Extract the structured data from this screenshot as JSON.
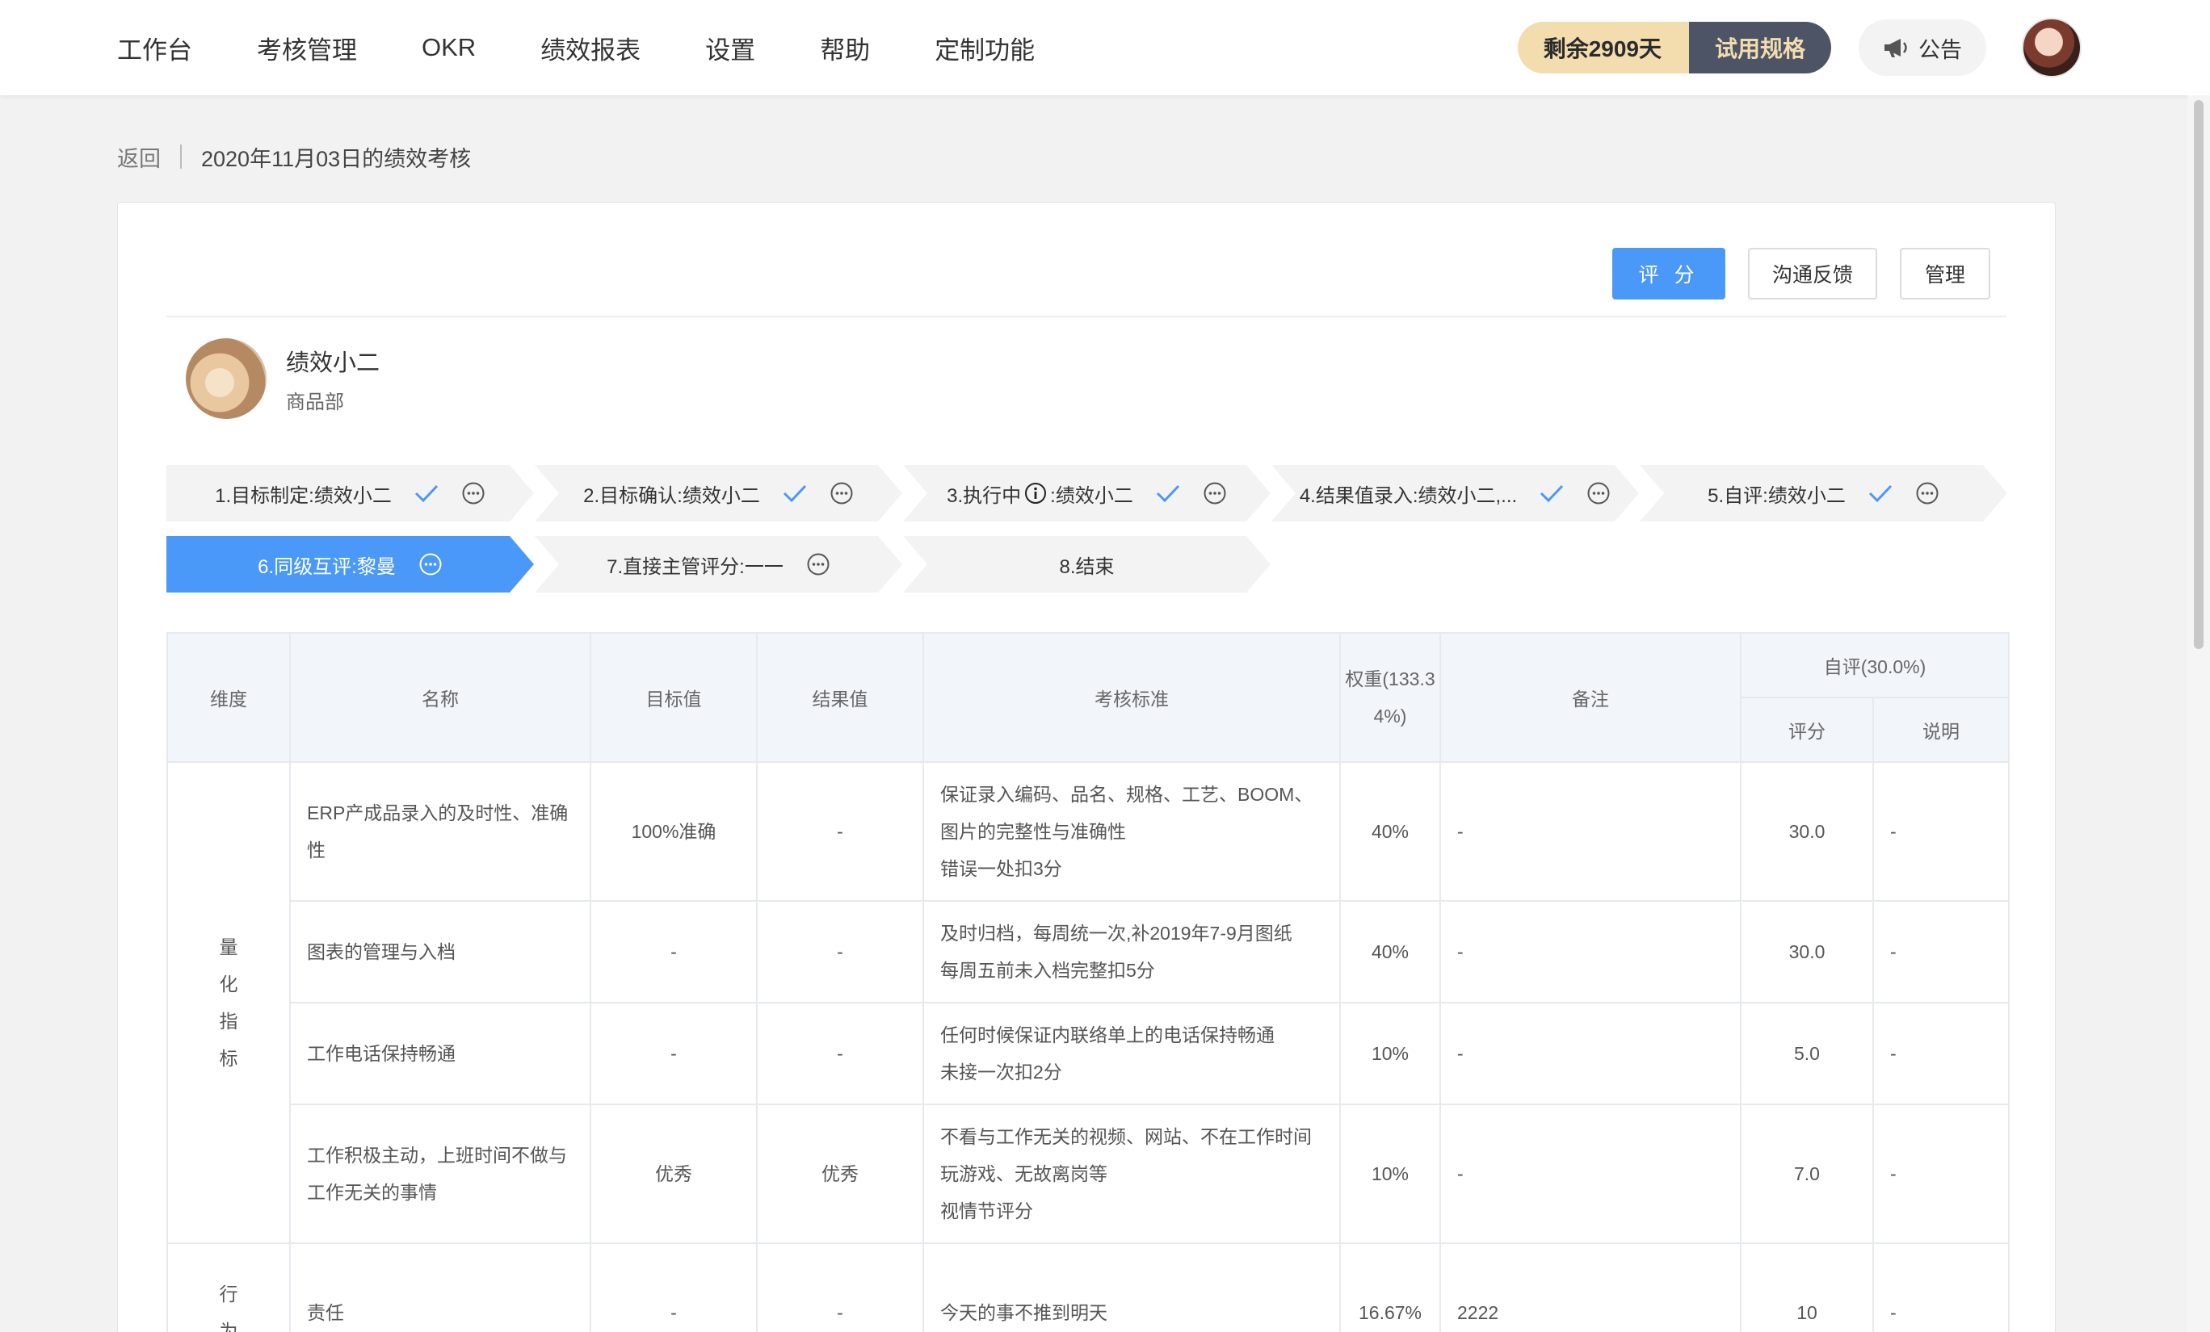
{
  "nav": {
    "items": [
      "工作台",
      "考核管理",
      "OKR",
      "绩效报表",
      "设置",
      "帮助",
      "定制功能"
    ],
    "trial_remaining": "剩余2909天",
    "trial_spec": "试用规格",
    "notice": "公告"
  },
  "breadcrumb": {
    "back": "返回",
    "title": "2020年11月03日的绩效考核"
  },
  "actions": {
    "score": "评 分",
    "feedback": "沟通反馈",
    "manage": "管理"
  },
  "person": {
    "name": "绩效小二",
    "dept": "商品部"
  },
  "steps": [
    {
      "label": "1.目标制定:绩效小二",
      "done": true,
      "more": true,
      "active": false
    },
    {
      "label": "2.目标确认:绩效小二",
      "done": true,
      "more": true,
      "active": false
    },
    {
      "label_pre": "3.执行中",
      "label_post": ":绩效小二",
      "info": true,
      "done": true,
      "more": true,
      "active": false
    },
    {
      "label": "4.结果值录入:绩效小二,...",
      "done": true,
      "more": true,
      "active": false
    },
    {
      "label": "5.自评:绩效小二",
      "done": true,
      "more": true,
      "active": false
    },
    {
      "label": "6.同级互评:黎曼",
      "done": false,
      "more": true,
      "active": true
    },
    {
      "label": "7.直接主管评分:一一",
      "done": false,
      "more": true,
      "active": false
    },
    {
      "label": "8.结束",
      "done": false,
      "more": false,
      "active": false
    }
  ],
  "table": {
    "headers": {
      "dimension": "维度",
      "name": "名称",
      "target": "目标值",
      "result": "结果值",
      "standard": "考核标准",
      "weight": "权重(133.34%)",
      "note": "备注",
      "self_eval": "自评(30.0%)",
      "score": "评分",
      "explain": "说明"
    },
    "groups": [
      {
        "dimension": "量化指标",
        "rows": [
          {
            "name": "ERP产成品录入的及时性、准确性",
            "target": "100%准确",
            "result": "-",
            "standard": "保证录入编码、品名、规格、工艺、BOOM、图片的完整性与准确性\n错误一处扣3分",
            "weight": "40%",
            "note": "-",
            "score": "30.0",
            "explain": "-"
          },
          {
            "name": "图表的管理与入档",
            "target": "-",
            "result": "-",
            "standard": "及时归档，每周统一次,补2019年7-9月图纸\n每周五前未入档完整扣5分",
            "weight": "40%",
            "note": "-",
            "score": "30.0",
            "explain": "-"
          },
          {
            "name": "工作电话保持畅通",
            "target": "-",
            "result": "-",
            "standard": "任何时候保证内联络单上的电话保持畅通\n未接一次扣2分",
            "weight": "10%",
            "note": "-",
            "score": "5.0",
            "explain": "-"
          },
          {
            "name": "工作积极主动，上班时间不做与工作无关的事情",
            "target": "优秀",
            "result": "优秀",
            "standard": "不看与工作无关的视频、网站、不在工作时间玩游戏、无故离岗等\n视情节评分",
            "weight": "10%",
            "note": "-",
            "score": "7.0",
            "explain": "-"
          }
        ]
      },
      {
        "dimension": "行为",
        "rows": [
          {
            "name": "责任",
            "target": "-",
            "result": "-",
            "standard": "今天的事不推到明天",
            "weight": "16.67%",
            "note": "2222",
            "score": "10",
            "explain": "-"
          }
        ]
      }
    ]
  }
}
